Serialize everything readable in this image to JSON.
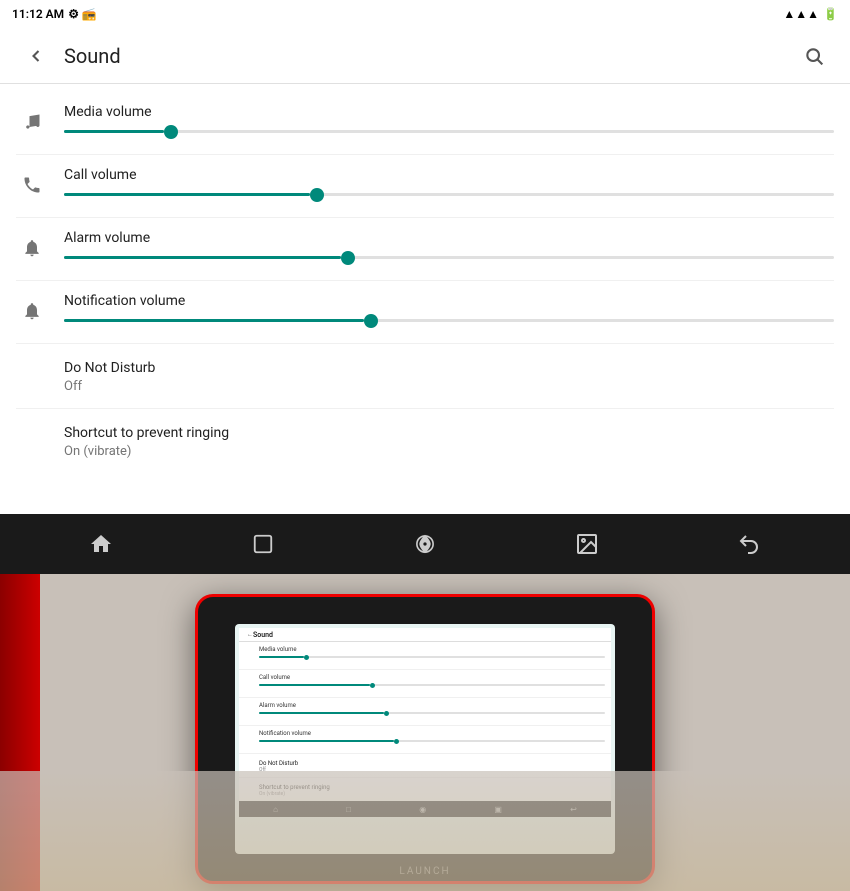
{
  "statusBar": {
    "time": "11:12 AM",
    "batteryIcon": "🔋",
    "wifiIcon": "📶",
    "signalIcon": "📡"
  },
  "header": {
    "title": "Sound",
    "backLabel": "←",
    "searchLabel": "🔍"
  },
  "sliders": [
    {
      "id": "media",
      "label": "Media volume",
      "icon": "music",
      "fillPercent": 13,
      "thumbPercent": 13
    },
    {
      "id": "call",
      "label": "Call volume",
      "icon": "phone",
      "fillPercent": 32,
      "thumbPercent": 32
    },
    {
      "id": "alarm",
      "label": "Alarm volume",
      "icon": "alarm",
      "fillPercent": 36,
      "thumbPercent": 36
    },
    {
      "id": "notification",
      "label": "Notification volume",
      "icon": "bell",
      "fillPercent": 39,
      "thumbPercent": 39
    }
  ],
  "settingItems": [
    {
      "id": "do-not-disturb",
      "title": "Do Not Disturb",
      "subtitle": "Off"
    },
    {
      "id": "shortcut-ringing",
      "title": "Shortcut to prevent ringing",
      "subtitle": "On (vibrate)"
    }
  ],
  "navBar": {
    "home": "⌂",
    "recents": "□",
    "custom": "⊡",
    "image": "🖼",
    "back": "↩"
  },
  "tablet": {
    "brand": "LAUNCH",
    "sliders": [
      {
        "label": "Media volume",
        "fill": 13
      },
      {
        "label": "Call volume",
        "fill": 32
      },
      {
        "label": "Alarm volume",
        "fill": 36
      },
      {
        "label": "Notification volume",
        "fill": 39
      }
    ]
  }
}
